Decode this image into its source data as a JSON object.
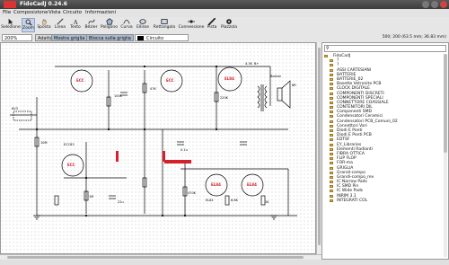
{
  "window": {
    "title": "FidoCadJ 0.24.6"
  },
  "menu": [
    "File",
    "Composizione",
    "Vista",
    "Circuito",
    "Informazioni"
  ],
  "tools": [
    {
      "label": "Selezione",
      "icon": "arrow-icon"
    },
    {
      "label": "Zoom",
      "icon": "zoom-icon",
      "active": true
    },
    {
      "label": "Sposta",
      "icon": "hand-icon"
    },
    {
      "label": "Linea",
      "icon": "line-icon"
    },
    {
      "label": "Testo",
      "icon": "text-icon"
    },
    {
      "label": "Bézier",
      "icon": "bezier-icon"
    },
    {
      "label": "Poligono",
      "icon": "polygon-icon"
    },
    {
      "label": "Curva",
      "icon": "curve-icon"
    },
    {
      "label": "Ellisse",
      "icon": "ellipse-icon"
    },
    {
      "label": "Rettangolo",
      "icon": "rectangle-icon"
    },
    {
      "label": "Connessione",
      "icon": "connection-icon"
    },
    {
      "label": "Pista",
      "icon": "track-icon"
    },
    {
      "label": "Piazzola",
      "icon": "pad-icon"
    }
  ],
  "options": {
    "zoom": "200%",
    "fit": "Adatta",
    "show_grid": "Mostra griglia",
    "snap_grid": "Blocca sulla griglia",
    "layer": "Circuito"
  },
  "coords": "500; 200 (63.5 mm; 36.83 mm)",
  "library": {
    "root": "FidoCadJ",
    "items": [
      "?",
      "?",
      "ASSI CARTESIANI",
      "BATTERIE",
      "BATTERIE_02",
      "Basette Vetronite PCB",
      "CLOCK DIGITALE",
      "COMPONENTI DISCRETI",
      "COMPONENTI SPECIALI",
      "CONNETTORE COASSIALE",
      "CONTENITORI DIL",
      "Componenti SMD",
      "Condensatori Ceramici",
      "Condensatori PCB_Comuni_02",
      "Connettori Vari",
      "Diodi E Ponti",
      "Diodi E Ponti PCB",
      "EDTSF",
      "EY_Libraries",
      "Elementi Radianti",
      "FIBRA OTTICA",
      "FLIP FLOP",
      "FOR-ma",
      "GRIGLIA",
      "Grandi-compo",
      "Grandi-compo_rev",
      "IC Narrow Pads",
      "IC SMD Pin",
      "IC Wide Pads",
      "INRIM 3.1",
      "INTEGRATI COL"
    ]
  },
  "schematic": {
    "labels": [
      "B+",
      "Boston",
      "4.3K",
      "6V3",
      "100K",
      "47K",
      "220K",
      "EL84",
      "ECC83",
      "10M",
      "1M",
      "470K",
      "6.8K",
      "1K",
      "22u",
      "0.1u",
      "8R"
    ]
  }
}
